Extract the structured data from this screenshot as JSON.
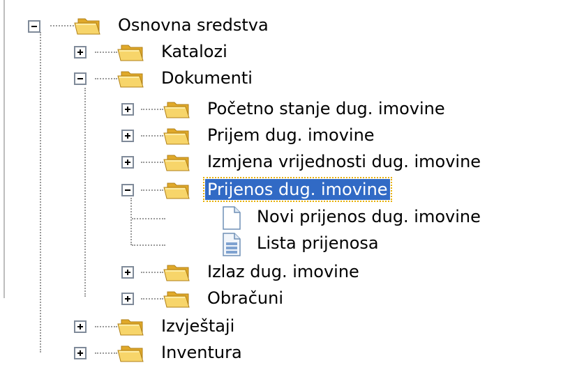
{
  "tree": {
    "root": {
      "label": "Osnovna sredstva",
      "expanded": true
    },
    "katalozi": {
      "label": "Katalozi",
      "expanded": false
    },
    "dokumenti": {
      "label": "Dokumenti",
      "expanded": true,
      "children": {
        "pocetno": {
          "label": "Početno stanje dug. imovine",
          "expanded": false
        },
        "prijem": {
          "label": "Prijem dug. imovine",
          "expanded": false
        },
        "izmjena": {
          "label": "Izmjena vrijednosti dug. imovine",
          "expanded": false
        },
        "prijenos": {
          "label": "Prijenos dug. imovine",
          "expanded": true,
          "selected": true,
          "children": {
            "novi": {
              "label": "Novi prijenos dug. imovine",
              "icon": "new-document-icon"
            },
            "lista": {
              "label": "Lista prijenosa",
              "icon": "list-document-icon"
            }
          }
        },
        "izlaz": {
          "label": "Izlaz dug. imovine",
          "expanded": false
        },
        "obracuni": {
          "label": "Obračuni",
          "expanded": false
        }
      }
    },
    "izvjestaji": {
      "label": "Izvještaji",
      "expanded": false
    },
    "inventura": {
      "label": "Inventura",
      "expanded": false
    }
  },
  "colors": {
    "selection": "#316ac5",
    "selection_text": "#ffffff",
    "folder": "#f2c94c",
    "connector": "#9a9a9a"
  }
}
